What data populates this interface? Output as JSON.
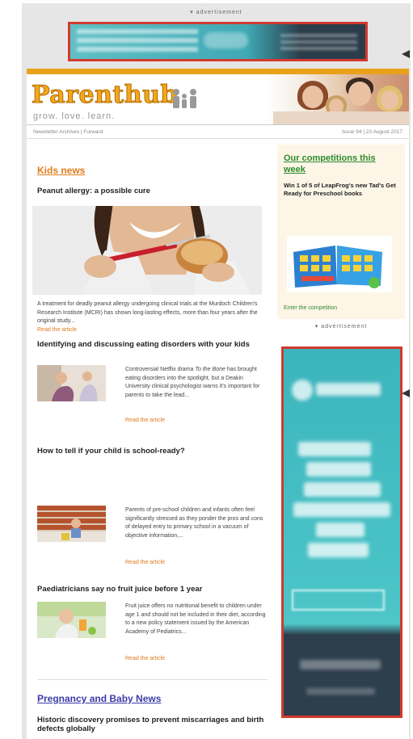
{
  "top_ad": {
    "label": "▾ advertisement"
  },
  "newsletter": {
    "logo_text": "Parenthub",
    "tagline": "grow. love. learn.",
    "subbar_left": "Newsletter Archives | Forward",
    "subbar_right": "Issue 94 | 23 August 2017"
  },
  "main": {
    "section1_title": "Kids news",
    "article1": {
      "headline": "Peanut allergy: a possible cure",
      "body": "A treatment for deadly peanut allergy undergoing clinical trials at the Murdoch Children's Research Institute (MCRI) has shown long-lasting effects, more than four years after the original study...",
      "link": "Read the article"
    },
    "article2": {
      "headline": "Identifying and discussing eating disorders with your kids",
      "body_pre": "Controversial Netflix drama ",
      "body_em": "To the Bone",
      "body_post": " has brought eating disorders into the spotlight, but a Deakin University clinical psychologist warns it's important for parents to take the lead...",
      "link": "Read the article"
    },
    "article3": {
      "headline": "How to tell if your child is school-ready?",
      "body": "Parents of pre-school children and infants often feel significantly stressed as they ponder the pros and cons of delayed entry to primary school in a vacuum of objective information,...",
      "link": "Read the article"
    },
    "article4": {
      "headline": "Paediatricians say no fruit juice before 1 year",
      "body": "Fruit juice offers no nutritional benefit to children under age 1 and should not be included in their diet, according to a new policy statement issued by the American Academy of Pediatrics...",
      "link": "Read the article"
    },
    "section2_title": "Pregnancy and Baby News",
    "article5": {
      "headline": "Historic discovery promises to prevent miscarriages and birth defects globally"
    }
  },
  "sidebar": {
    "comp_title": "Our competitions this week",
    "comp_text": "Win 1 of 5 of LeapFrog's new Tad's Get Ready for Preschool books",
    "comp_link": "Enter the competition",
    "ad_label": "▾ advertisement"
  },
  "colors": {
    "ad_border": "#d23a2f",
    "brand_gold": "#e8a21a",
    "kids_news": "#e07b1b",
    "competition_green": "#2e8b2e",
    "pregnancy_blue": "#3b3ba8"
  }
}
